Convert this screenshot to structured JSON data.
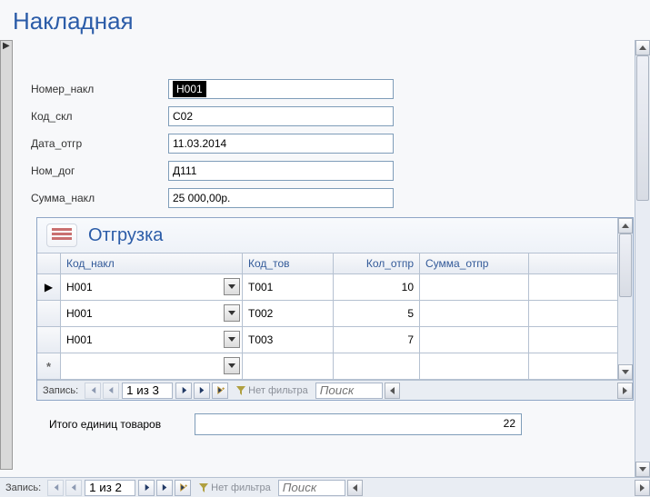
{
  "title": "Накладная",
  "fields": {
    "nomer_nakl": {
      "label": "Номер_накл",
      "value": "Н001"
    },
    "kod_skl": {
      "label": "Код_скл",
      "value": "С02"
    },
    "data_otgr": {
      "label": "Дата_отгр",
      "value": "11.03.2014"
    },
    "nom_dog": {
      "label": "Ном_дог",
      "value": "Д111"
    },
    "summa_nakl": {
      "label": "Сумма_накл",
      "value": "25 000,00р."
    }
  },
  "subform": {
    "title": "Отгрузка",
    "columns": {
      "kod_nakl": "Код_накл",
      "kod_tov": "Код_тов",
      "kol_otpr": "Кол_отпр",
      "summa_otpr": "Сумма_отпр"
    },
    "rows": [
      {
        "kod_nakl": "Н001",
        "kod_tov": "Т001",
        "kol_otpr": "10",
        "summa_otpr": ""
      },
      {
        "kod_nakl": "Н001",
        "kod_tov": "Т002",
        "kol_otpr": "5",
        "summa_otpr": ""
      },
      {
        "kod_nakl": "Н001",
        "kod_tov": "Т003",
        "kol_otpr": "7",
        "summa_otpr": ""
      }
    ],
    "nav": {
      "label": "Запись:",
      "counter": "1 из 3",
      "filter": "Нет фильтра",
      "search": "Поиск"
    }
  },
  "total": {
    "label": "Итого единиц товаров",
    "value": "22"
  },
  "main_nav": {
    "label": "Запись:",
    "counter": "1 из 2",
    "filter": "Нет фильтра",
    "search": "Поиск"
  }
}
